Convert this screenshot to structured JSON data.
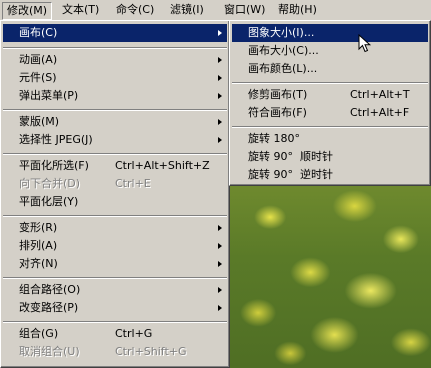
{
  "menubar": {
    "items": [
      "修改(M)",
      "文本(T)",
      "命令(C)",
      "滤镜(I)",
      "窗口(W)",
      "帮助(H)"
    ]
  },
  "modify_menu": {
    "items": [
      {
        "label": "画布(C)"
      },
      {
        "label": "动画(A)"
      },
      {
        "label": "元件(S)"
      },
      {
        "label": "弹出菜单(P)"
      },
      {
        "label": "蒙版(M)"
      },
      {
        "label": "选择性 JPEG(J)"
      },
      {
        "label": "平面化所选(F)",
        "shortcut": "Ctrl+Alt+Shift+Z"
      },
      {
        "label": "向下合并(D)",
        "shortcut": "Ctrl+E"
      },
      {
        "label": "平面化层(Y)"
      },
      {
        "label": "变形(R)"
      },
      {
        "label": "排列(A)"
      },
      {
        "label": "对齐(N)"
      },
      {
        "label": "组合路径(O)"
      },
      {
        "label": "改变路径(P)"
      },
      {
        "label": "组合(G)",
        "shortcut": "Ctrl+G"
      },
      {
        "label": "取消组合(U)",
        "shortcut": "Ctrl+Shift+G"
      }
    ]
  },
  "canvas_submenu": {
    "items": [
      {
        "label": "图象大小(I)..."
      },
      {
        "label": "画布大小(C)..."
      },
      {
        "label": "画布颜色(L)..."
      },
      {
        "label": "修剪画布(T)",
        "shortcut": "Ctrl+Alt+T"
      },
      {
        "label": "符合画布(F)",
        "shortcut": "Ctrl+Alt+F"
      },
      {
        "label": "旋转 180°"
      },
      {
        "label": "旋转 90°  顺时针"
      },
      {
        "label": "旋转 90°  逆时针"
      }
    ]
  },
  "colors": {
    "highlight": "#0a246a",
    "menu_bg": "#d4d0c8",
    "disabled": "#808080"
  },
  "icons": {
    "submenu": "triangle-right",
    "cursor": "arrow-pointer"
  }
}
